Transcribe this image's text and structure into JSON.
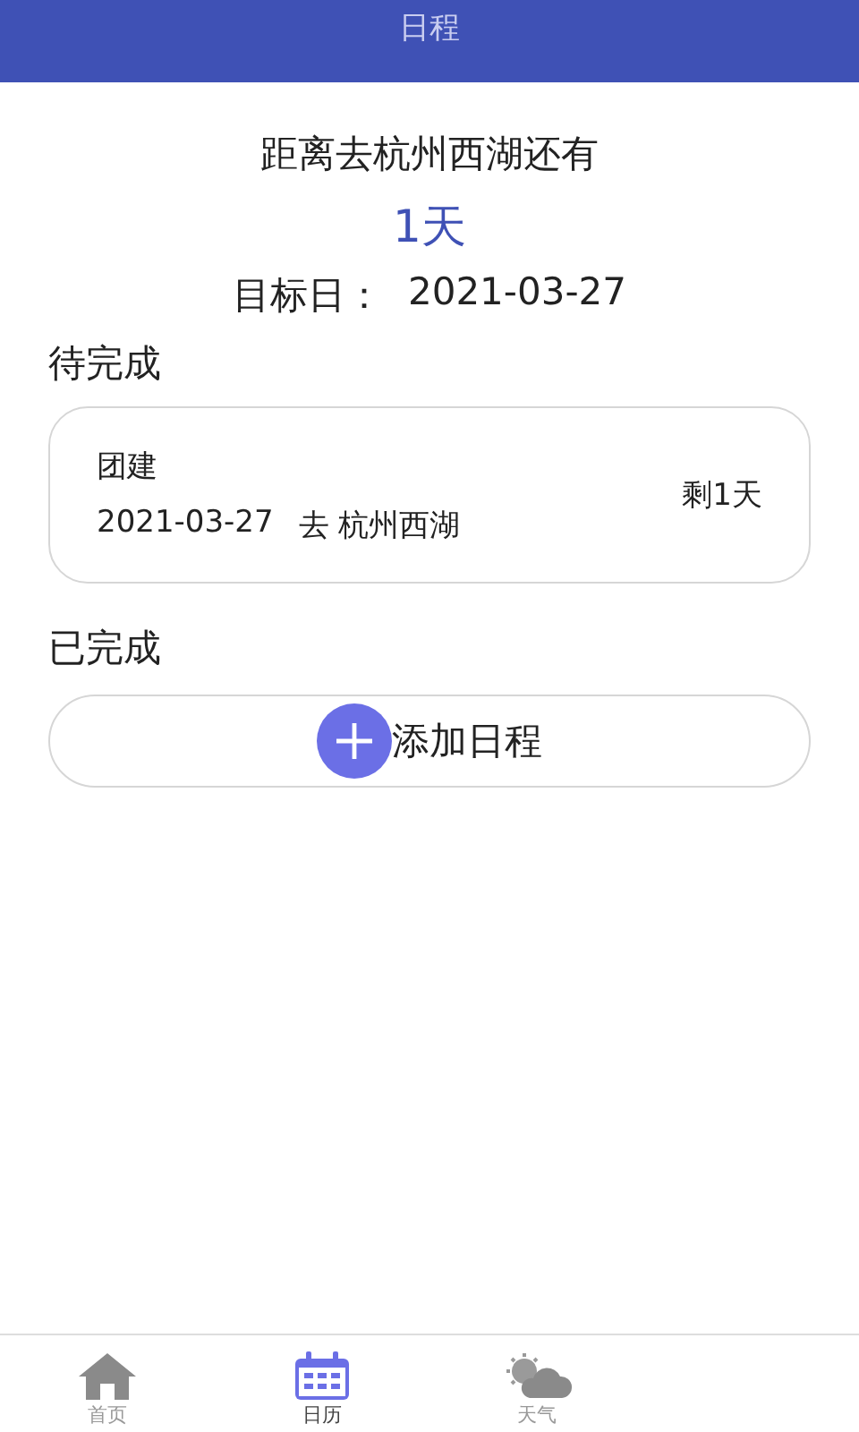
{
  "header": {
    "title": "日程"
  },
  "countdown": {
    "caption": "距离去杭州西湖还有",
    "days": "1天",
    "target_label": "目标日：",
    "target_date": "2021-03-27"
  },
  "pending": {
    "heading": "待完成",
    "items": [
      {
        "title": "团建",
        "date": "2021-03-27",
        "place": "去 杭州西湖",
        "remaining": "剩1天"
      }
    ]
  },
  "done": {
    "heading": "已完成"
  },
  "add_button": {
    "label": "添加日程"
  },
  "tabs": [
    {
      "kind": "home",
      "label": "首页",
      "selected": false
    },
    {
      "kind": "calendar",
      "label": "日历",
      "selected": true
    },
    {
      "kind": "weather",
      "label": "天气",
      "selected": false
    }
  ]
}
